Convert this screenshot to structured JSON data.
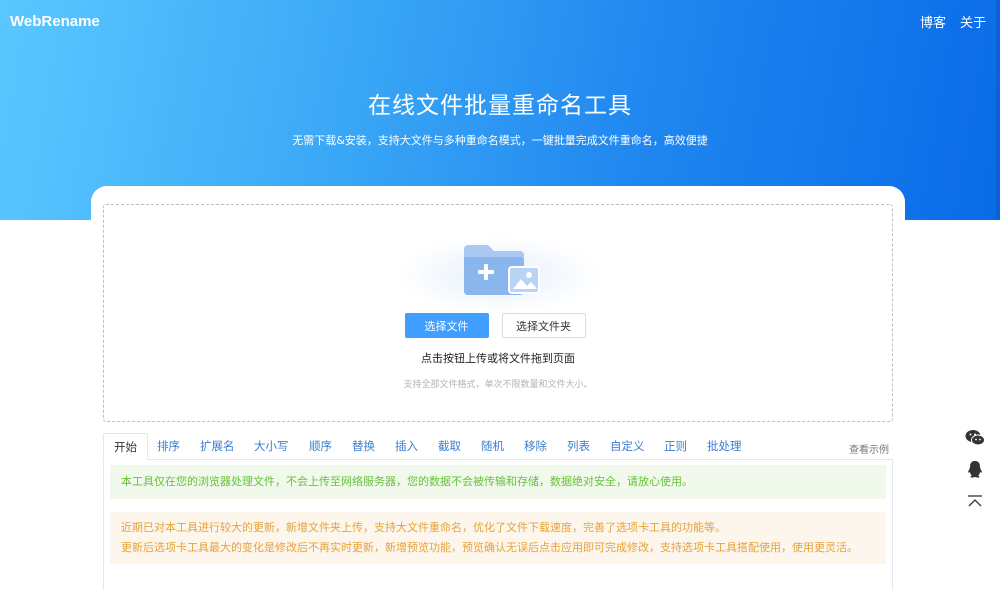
{
  "header": {
    "brand": "WebRename",
    "nav": [
      "博客",
      "关于"
    ]
  },
  "hero": {
    "title": "在线文件批量重命名工具",
    "subtitle": "无需下载&安装，支持大文件与多种重命名模式，一键批量完成文件重命名，高效便捷"
  },
  "upload": {
    "icon": "folder-add-icon",
    "select_files": "选择文件",
    "select_folder": "选择文件夹",
    "main_text": "点击按钮上传或将文件拖到页面",
    "hint": "支持全部文件格式，单次不限数量和文件大小。"
  },
  "tabs": [
    "开始",
    "排序",
    "扩展名",
    "大小写",
    "顺序",
    "替换",
    "插入",
    "截取",
    "随机",
    "移除",
    "列表",
    "自定义",
    "正则",
    "批处理"
  ],
  "active_tab": "开始",
  "view_example": "查看示例",
  "notices": {
    "privacy": "本工具仅在您的浏览器处理文件，不会上传至网络服务器，您的数据不会被传输和存储，数据绝对安全，请放心使用。",
    "update_line1": "近期已对本工具进行较大的更新，新增文件夹上传，支持大文件重命名，优化了文件下载速度，完善了选项卡工具的功能等。",
    "update_line2": "更新后选项卡工具最大的变化是修改后不再实时更新，新增预览功能，预览确认无误后点击应用即可完成修改，支持选项卡工具搭配使用，使用更灵活。"
  },
  "side_buttons": [
    "wechat-icon",
    "qq-icon",
    "back-to-top-icon"
  ],
  "colors": {
    "primary": "#409eff",
    "success_text": "#67c23a",
    "success_bg": "#f0f9eb",
    "warning_text": "#e6a23c",
    "warning_bg": "#fdf6ec"
  }
}
